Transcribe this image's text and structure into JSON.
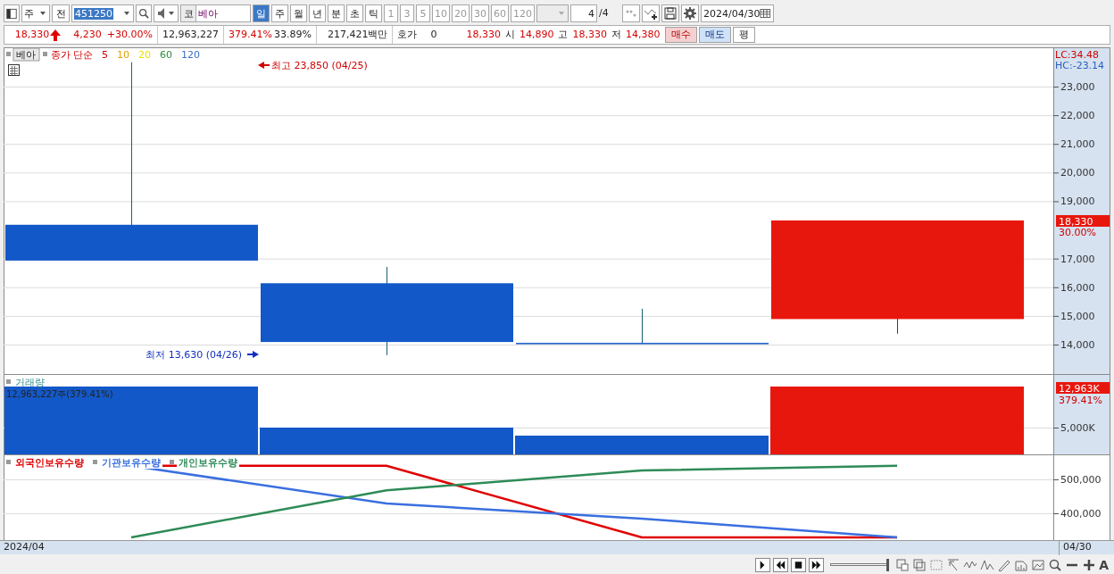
{
  "toolbar": {
    "market": "주",
    "prev_button": "전",
    "code": "451250",
    "exchange": "코",
    "name": "베아",
    "periods": [
      {
        "label": "일",
        "selected": true
      },
      {
        "label": "주",
        "selected": false
      },
      {
        "label": "월",
        "selected": false
      },
      {
        "label": "년",
        "selected": false
      },
      {
        "label": "분",
        "selected": false
      },
      {
        "label": "초",
        "selected": false
      },
      {
        "label": "틱",
        "selected": false
      }
    ],
    "intervals": [
      "1",
      "3",
      "5",
      "10",
      "20",
      "30",
      "60",
      "120"
    ],
    "page": "4",
    "page_total": "/4",
    "date": "2024/04/30"
  },
  "quote": {
    "price": "18,330",
    "change": "4,230",
    "change_rate": "+30.00%",
    "volume": "12,963,227",
    "volume_ratio": "379.41%",
    "turnover": "33.89%",
    "amount": "217,421백만",
    "ask_label": "호가",
    "ask": "0",
    "ask_price": "18,330",
    "open_label": "시",
    "open": "14,890",
    "high_label": "고",
    "high": "18,330",
    "low_label": "저",
    "low": "14,380",
    "buy": "매수",
    "sell": "매도",
    "avg": "평"
  },
  "price_panel": {
    "name_button": "베아",
    "ma_title": "종가 단순",
    "ma": [
      {
        "label": "5",
        "color": "#d00000"
      },
      {
        "label": "10",
        "color": "#e0a000"
      },
      {
        "label": "20",
        "color": "#e8e000"
      },
      {
        "label": "60",
        "color": "#2e8b3a"
      },
      {
        "label": "120",
        "color": "#3a6fc0"
      }
    ],
    "high_note": "최고 23,850 (04/25)",
    "low_note": "최저 13,630 (04/26)",
    "lc": "LC:34.48",
    "hc": "HC:-23.14",
    "axis_labels_upper": [
      "23,000",
      "22,000",
      "21,000",
      "20,000",
      "19,000"
    ],
    "axis_labels_lower": [
      "17,000",
      "16,000",
      "15,000",
      "14,000"
    ],
    "last_tag": "18,330",
    "last_rate": "30.00%"
  },
  "volume_panel": {
    "title": "거래량",
    "info": "12,963,227주(379.41%)",
    "axis_label": "5,000K",
    "last_tag": "12,963K",
    "last_rate": "379.41%"
  },
  "holdings_panel": {
    "legend": [
      {
        "label": "외국인보유수량",
        "color": "#e00000"
      },
      {
        "label": "기관보유수량",
        "color": "#3a6fe0"
      },
      {
        "label": "개인보유수량",
        "color": "#2e8b57"
      }
    ],
    "axis_labels": [
      "500,000",
      "400,000"
    ]
  },
  "date_bar": {
    "start": "2024/04",
    "end": "04/30"
  },
  "footer": {
    "slider": {
      "level": 1
    },
    "font_button": "A"
  }
}
